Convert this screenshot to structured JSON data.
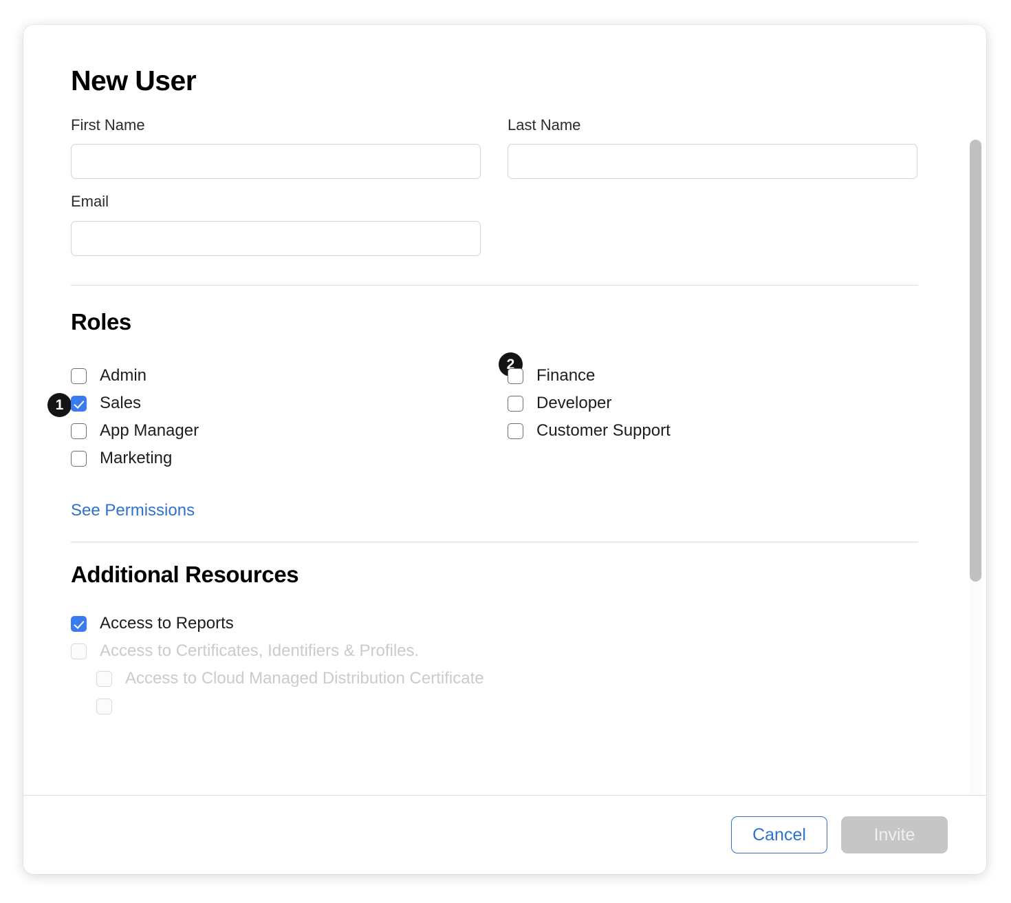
{
  "dialog": {
    "title": "New User"
  },
  "form": {
    "first_name": {
      "label": "First Name",
      "value": "",
      "placeholder": ""
    },
    "last_name": {
      "label": "Last Name",
      "value": "",
      "placeholder": ""
    },
    "email": {
      "label": "Email",
      "value": "",
      "placeholder": ""
    }
  },
  "roles": {
    "heading": "Roles",
    "left": [
      {
        "label": "Admin",
        "checked": false
      },
      {
        "label": "Sales",
        "checked": true
      },
      {
        "label": "App Manager",
        "checked": false
      },
      {
        "label": "Marketing",
        "checked": false
      }
    ],
    "right": [
      {
        "label": "Finance",
        "checked": false
      },
      {
        "label": "Developer",
        "checked": false
      },
      {
        "label": "Customer Support",
        "checked": false
      }
    ],
    "permissions_link": "See Permissions",
    "badges": [
      {
        "number": "1"
      },
      {
        "number": "2"
      }
    ]
  },
  "additional_resources": {
    "heading": "Additional Resources",
    "items": [
      {
        "label": "Access to Reports",
        "checked": true,
        "disabled": false,
        "indent": false
      },
      {
        "label": "Access to Certificates, Identifiers & Profiles.",
        "checked": false,
        "disabled": true,
        "indent": false
      },
      {
        "label": "Access to Cloud Managed Distribution Certificate",
        "checked": false,
        "disabled": true,
        "indent": true
      }
    ]
  },
  "footer": {
    "cancel_label": "Cancel",
    "invite_label": "Invite"
  },
  "colors": {
    "accent_blue": "#3b7bf0",
    "link_blue": "#2e72cf",
    "badge_black": "#141414",
    "disabled_gray": "#c6c6c6",
    "muted_text": "#cbcbcb"
  }
}
